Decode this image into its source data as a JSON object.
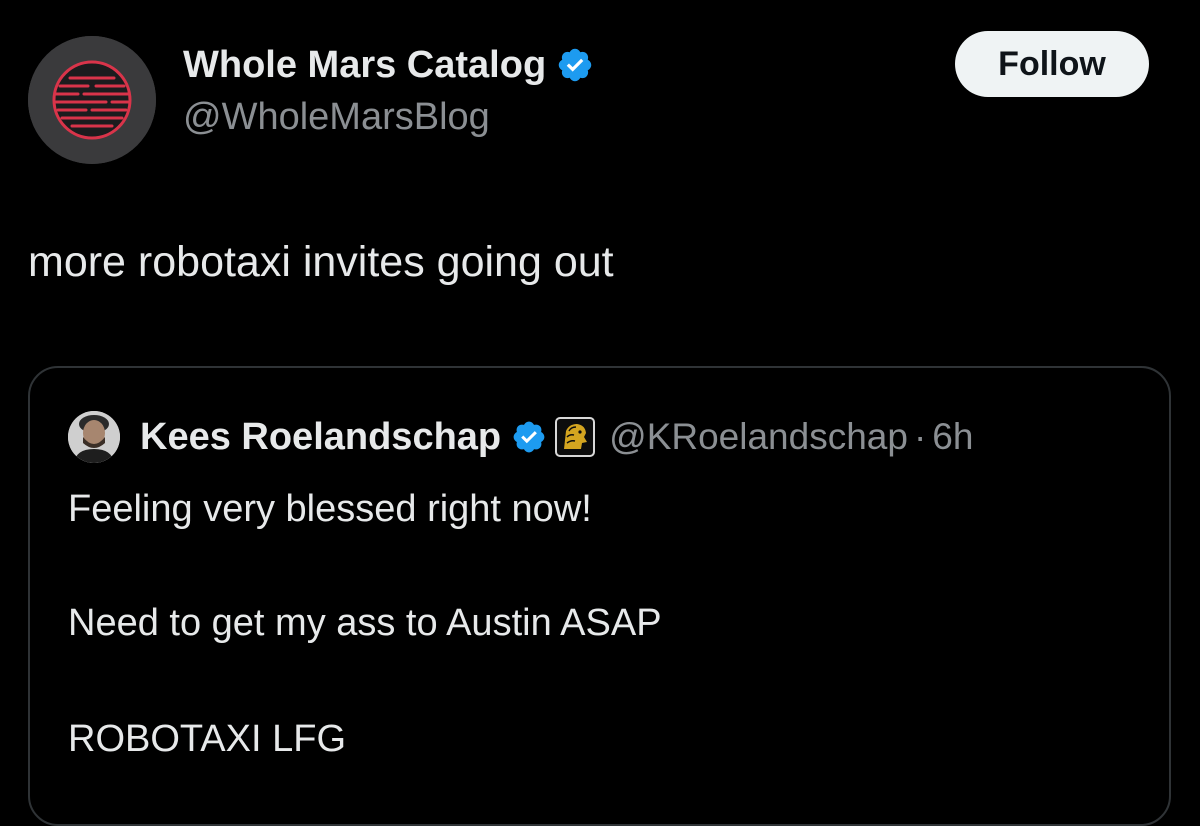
{
  "tweet": {
    "author": {
      "display_name": "Whole Mars Catalog",
      "handle": "@WholeMarsBlog",
      "verified": true,
      "avatar_icon": "red-striped-mars-icon"
    },
    "follow_label": "Follow",
    "text": "more robotaxi invites going out"
  },
  "quoted_tweet": {
    "author": {
      "display_name": "Kees Roelandschap",
      "handle": "@KRoelandschap",
      "verified": true,
      "affiliate_badge_icon": "gold-lion-badge-icon"
    },
    "separator": "·",
    "time": "6h",
    "lines": [
      "Feeling very blessed right now!",
      "Need to get my ass to Austin ASAP",
      "ROBOTAXI LFG"
    ]
  },
  "colors": {
    "background": "#000000",
    "text_primary": "#e7e9ea",
    "text_secondary": "#8b8f93",
    "verified_blue": "#1d9bf0",
    "follow_button_bg": "#eff3f4",
    "card_border": "#2f3336",
    "avatar_red": "#d9344a"
  }
}
